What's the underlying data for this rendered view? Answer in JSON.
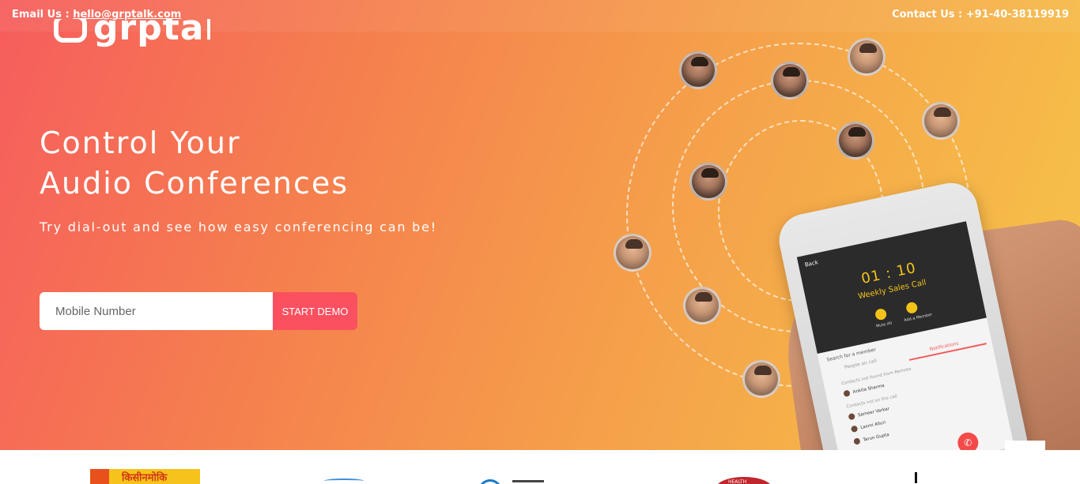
{
  "topbar": {
    "email_label": "Email Us :",
    "email": "hello@grptalk.com",
    "contact": "Contact Us : +91-40-38119919"
  },
  "brand": {
    "name": "grptalk"
  },
  "hero": {
    "headline_line1": "Control Your",
    "headline_line2": "Audio Conferences",
    "subline": "Try dial-out and see how easy conferencing can be!",
    "input_placeholder": "Mobile Number",
    "cta_label": "START DEMO"
  },
  "phone_screen": {
    "back": "Back",
    "timer": "01 : 10",
    "call_name": "Weekly Sales Call",
    "control1": "Mute All",
    "control2": "Add a Member",
    "search": "Search for a member",
    "tab1": "People on call",
    "tab2": "Notifications",
    "section1": "Contacts not found from Remote",
    "member1": "Ankita Sharma",
    "section2": "Contacts not on the call",
    "member2": "Sameer Varkar",
    "member3": "Laxmi Alluri",
    "member4": "Tarun Gupta"
  },
  "colors": {
    "gradient_start": "#f65d5d",
    "gradient_end": "#f6c548",
    "cta": "#fb5060"
  },
  "clients": {
    "logo1_text": "किसीनमोकि"
  }
}
